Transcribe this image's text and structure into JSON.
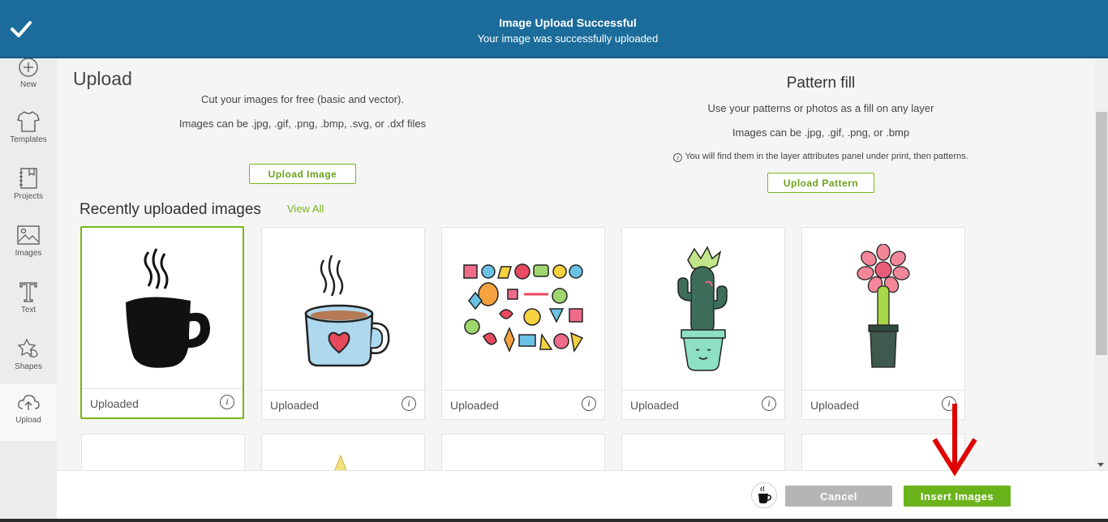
{
  "notification": {
    "title": "Image Upload Successful",
    "message": "Your image was successfully uploaded"
  },
  "sidebar": {
    "items": [
      {
        "label": "New",
        "icon": "plus-circle-icon"
      },
      {
        "label": "Templates",
        "icon": "tshirt-icon"
      },
      {
        "label": "Projects",
        "icon": "notebook-icon"
      },
      {
        "label": "Images",
        "icon": "image-icon"
      },
      {
        "label": "Text",
        "icon": "text-t-icon"
      },
      {
        "label": "Shapes",
        "icon": "shapes-icon"
      },
      {
        "label": "Upload",
        "icon": "cloud-upload-icon"
      }
    ],
    "active": "Upload"
  },
  "upload": {
    "title": "Upload",
    "desc1": "Cut your images for free (basic and vector).",
    "desc2": "Images can be .jpg, .gif, .png, .bmp, .svg, or .dxf files",
    "button": "Upload Image"
  },
  "pattern": {
    "title": "Pattern fill",
    "desc1": "Use your patterns or photos as a fill on any layer",
    "desc2": "Images can be .jpg, .gif, .png, or .bmp",
    "note": "You will find them in the layer attributes panel under print, then patterns.",
    "button": "Upload Pattern"
  },
  "recent": {
    "title": "Recently uploaded images",
    "view_all": "View All",
    "items": [
      {
        "status": "Uploaded",
        "thumbnail": "black-coffee-mug",
        "selected": true
      },
      {
        "status": "Uploaded",
        "thumbnail": "blue-heart-mug"
      },
      {
        "status": "Uploaded",
        "thumbnail": "doodle-stickers"
      },
      {
        "status": "Uploaded",
        "thumbnail": "cactus-in-pot"
      },
      {
        "status": "Uploaded",
        "thumbnail": "pink-flower-cactus"
      }
    ]
  },
  "footer": {
    "cancel": "Cancel",
    "insert": "Insert Images"
  },
  "colors": {
    "banner": "#1b6c9b",
    "accent_green": "#7ab51d",
    "insert_button": "#6ab31b",
    "cancel_button": "#b5b5b5",
    "arrow_red": "#e00000"
  }
}
